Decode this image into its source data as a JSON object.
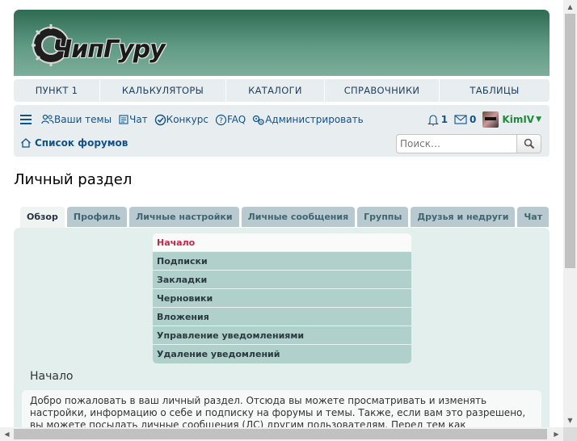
{
  "logo": {
    "text": "ЧипГуру"
  },
  "main_nav": [
    "ПУНКТ 1",
    "КАЛЬКУЛЯТОРЫ",
    "КАТАЛОГИ",
    "СПРАВОЧНИКИ",
    "ТАБЛИЦЫ"
  ],
  "sub_nav": {
    "links": {
      "my_topics": "Ваши темы",
      "chat": "Чат",
      "contest": "Конкурс",
      "faq": "FAQ",
      "admin": "Администрировать"
    },
    "notifications_count": "1",
    "messages_count": "0",
    "username": "KimIV",
    "forum_list": "Список форумов",
    "search_placeholder": "Поиск…"
  },
  "page_title": "Личный раздел",
  "tabs": [
    "Обзор",
    "Профиль",
    "Личные настройки",
    "Личные сообщения",
    "Группы",
    "Друзья и недруги",
    "Чат"
  ],
  "side_menu": [
    "Начало",
    "Подписки",
    "Закладки",
    "Черновики",
    "Вложения",
    "Управление уведомлениями",
    "Удаление уведомлений"
  ],
  "section_title": "Начало",
  "intro_text": "Добро пожаловать в ваш личный раздел. Отсюда вы можете просматривать и изменять настройки, информацию о себе и подписку на форумы и темы. Также, если вам это разрешено, вы можете посылать личные сообщения (ЛС) другим пользователям. Перед тем как продолжить, убедитесь, что вы",
  "colors": {
    "header": "#2f6b52",
    "link": "#105289",
    "active_menu": "#bc2a4d",
    "username": "#1f8a3a"
  }
}
